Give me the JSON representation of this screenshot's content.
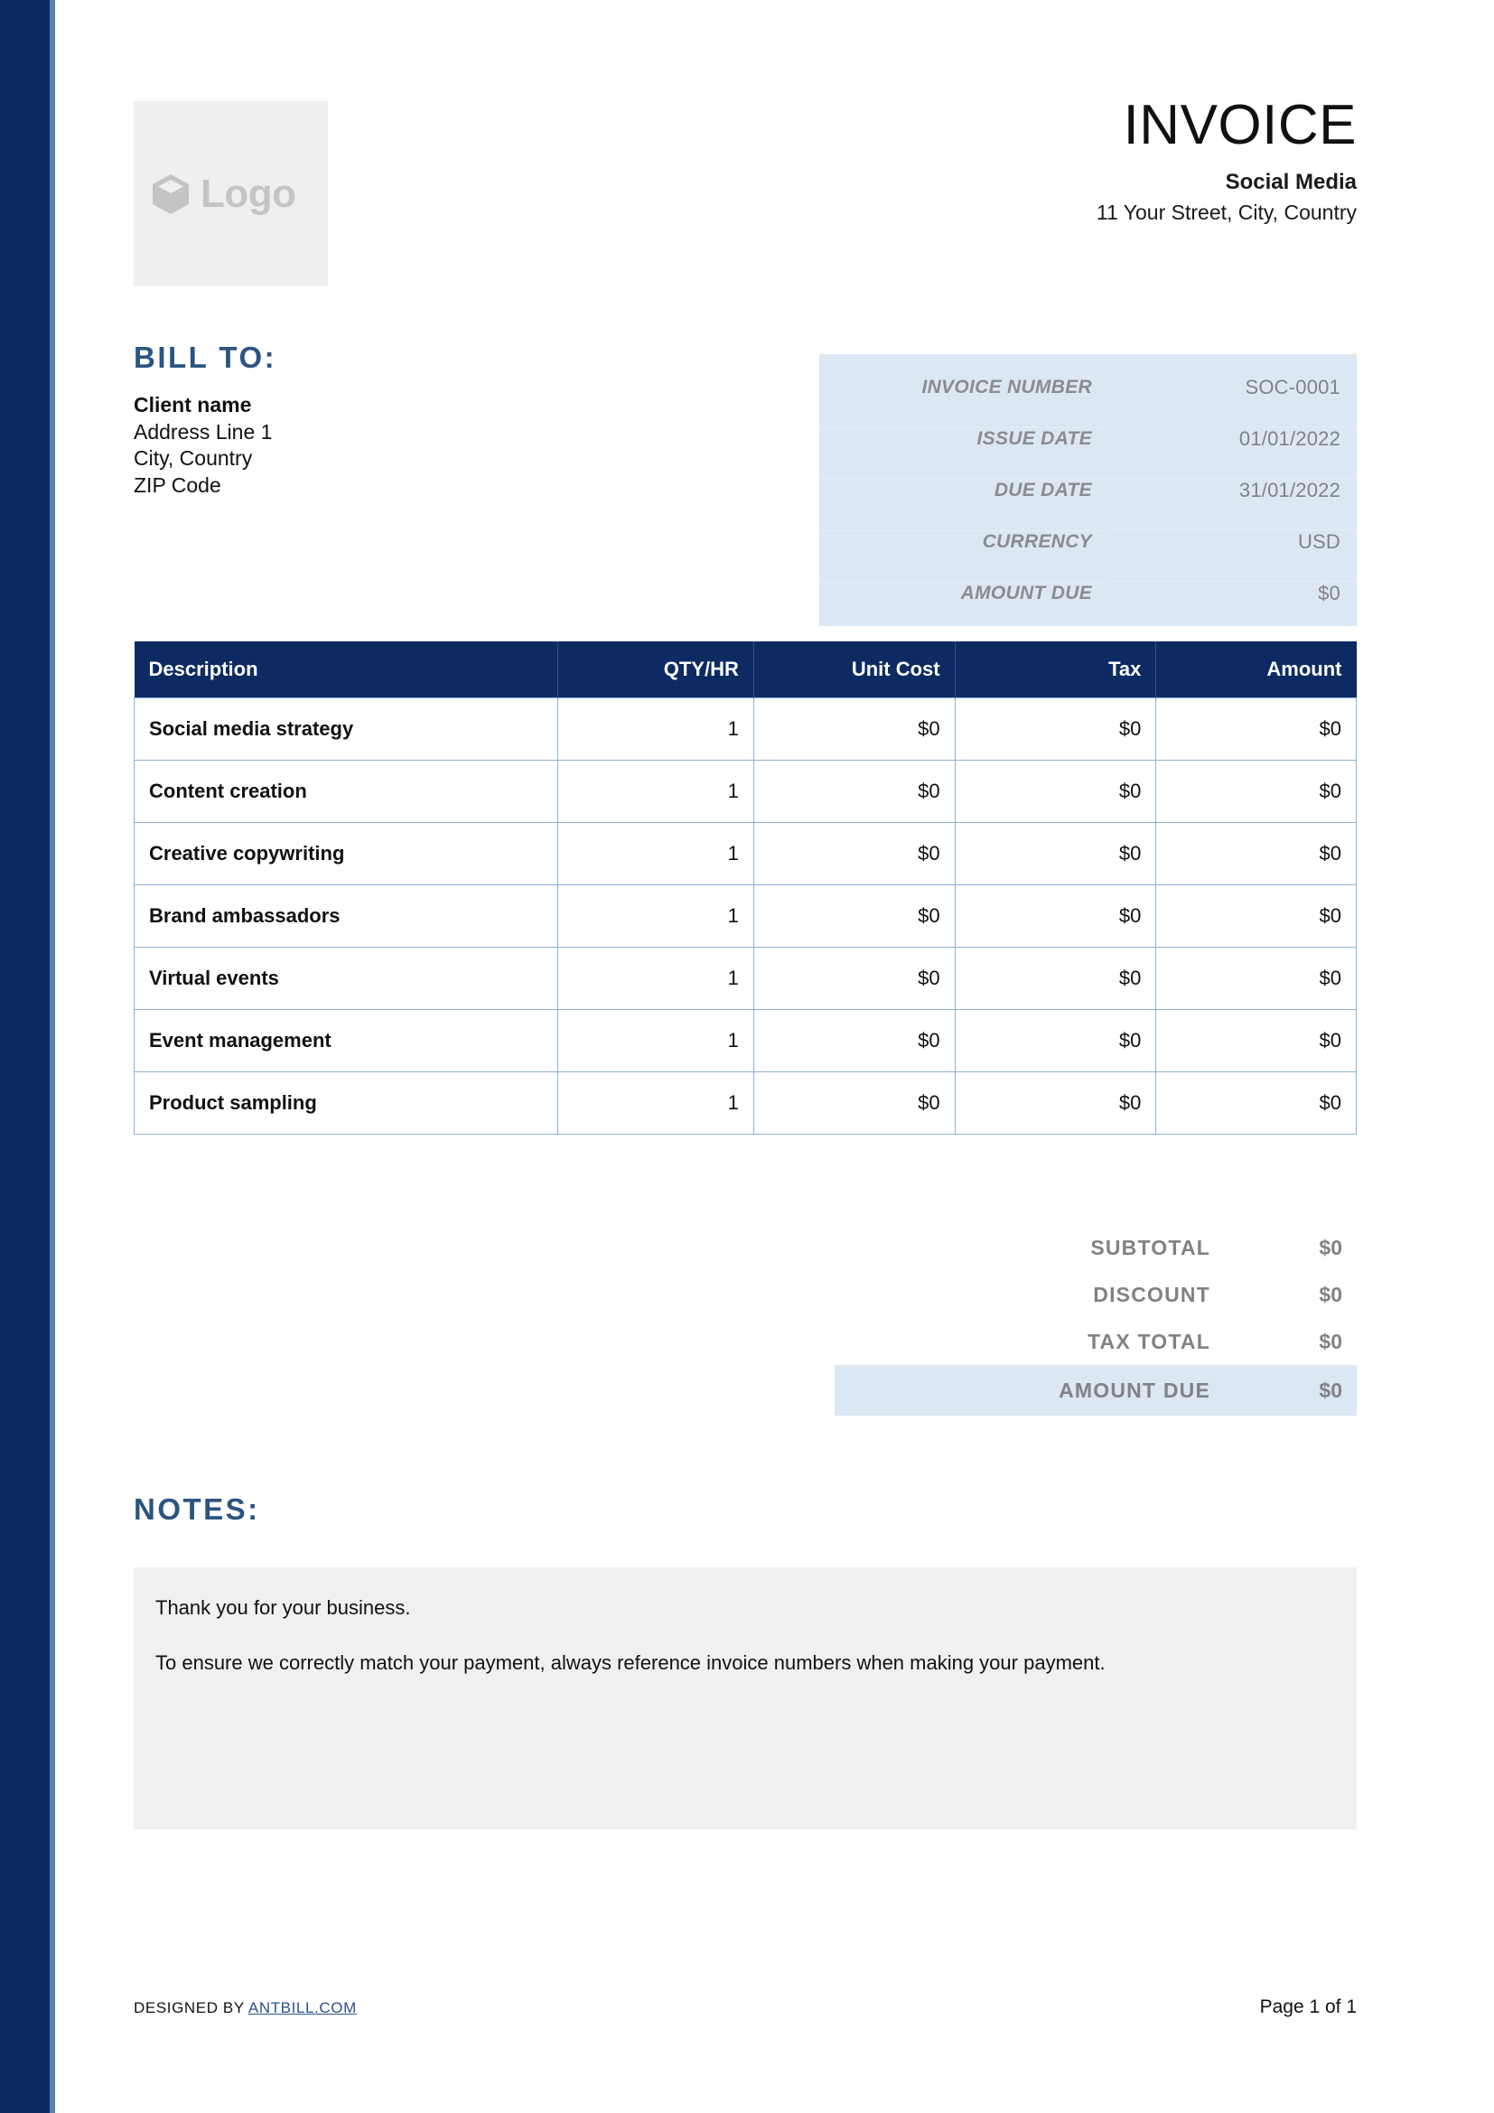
{
  "document": {
    "title": "INVOICE",
    "company_name": "Social Media",
    "company_address": "11 Your Street, City, Country"
  },
  "logo": {
    "icon": "cube-icon",
    "label": "Logo"
  },
  "bill_to": {
    "heading": "BILL TO:",
    "lines": [
      "Client name",
      "Address Line 1",
      "City, Country",
      "ZIP Code"
    ]
  },
  "invoice_details": [
    {
      "label": "INVOICE NUMBER",
      "value": "SOC-0001"
    },
    {
      "label": "ISSUE DATE",
      "value": "01/01/2022"
    },
    {
      "label": "DUE DATE",
      "value": "31/01/2022"
    },
    {
      "label": "CURRENCY",
      "value": "USD"
    },
    {
      "label": "AMOUNT DUE",
      "value": "$0"
    }
  ],
  "items_table": {
    "columns": [
      "Description",
      "QTY/HR",
      "Unit Cost",
      "Tax",
      "Amount"
    ],
    "rows": [
      {
        "description": "Social media strategy",
        "qty": "1",
        "unit_cost": "$0",
        "tax": "$0",
        "amount": "$0"
      },
      {
        "description": "Content creation",
        "qty": "1",
        "unit_cost": "$0",
        "tax": "$0",
        "amount": "$0"
      },
      {
        "description": "Creative copywriting",
        "qty": "1",
        "unit_cost": "$0",
        "tax": "$0",
        "amount": "$0"
      },
      {
        "description": "Brand ambassadors",
        "qty": "1",
        "unit_cost": "$0",
        "tax": "$0",
        "amount": "$0"
      },
      {
        "description": "Virtual events",
        "qty": "1",
        "unit_cost": "$0",
        "tax": "$0",
        "amount": "$0"
      },
      {
        "description": "Event management",
        "qty": "1",
        "unit_cost": "$0",
        "tax": "$0",
        "amount": "$0"
      },
      {
        "description": "Product sampling",
        "qty": "1",
        "unit_cost": "$0",
        "tax": "$0",
        "amount": "$0"
      }
    ]
  },
  "totals": [
    {
      "label": "SUBTOTAL",
      "value": "$0",
      "highlight": false
    },
    {
      "label": "DISCOUNT",
      "value": "$0",
      "highlight": false
    },
    {
      "label": "TAX TOTAL",
      "value": "$0",
      "highlight": false
    },
    {
      "label": "AMOUNT DUE",
      "value": "$0",
      "highlight": true
    }
  ],
  "notes": {
    "heading": "NOTES:",
    "paragraphs": [
      "Thank you for your business.",
      "To ensure we correctly match your payment, always reference invoice numbers when making your payment."
    ]
  },
  "footer": {
    "designed_by_prefix": "DESIGNED BY ",
    "designed_by_link": "ANTBILL.COM",
    "page_label": "Page 1 of 1"
  },
  "colors": {
    "navy": "#0B2A63",
    "steel": "#5C81AD",
    "heading_blue": "#2B5480",
    "panel_blue": "#DCE7F4",
    "table_border": "#8CB1D8",
    "notes_gray": "#F0F0F0",
    "muted_gray": "#808285",
    "link_blue": "#2B4F8C"
  }
}
